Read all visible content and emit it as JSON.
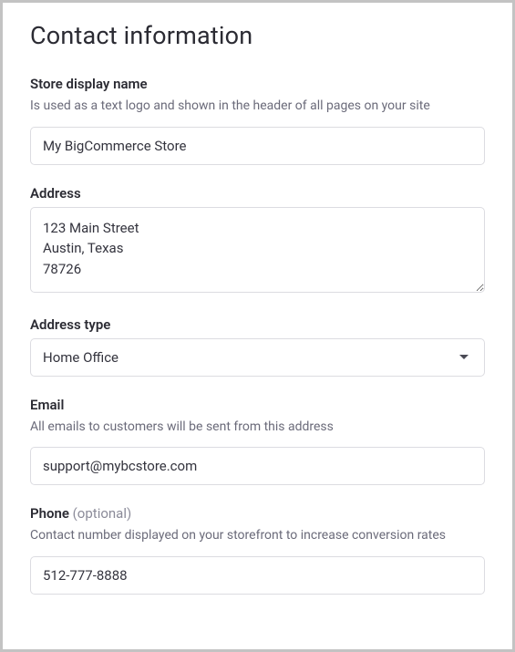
{
  "section": {
    "title": "Contact information"
  },
  "fields": {
    "store_display_name": {
      "label": "Store display name",
      "help": "Is used as a text logo and shown in the header of all pages on your site",
      "value": "My BigCommerce Store"
    },
    "address": {
      "label": "Address",
      "value": "123 Main Street\nAustin, Texas\n78726"
    },
    "address_type": {
      "label": "Address type",
      "selected": "Home Office"
    },
    "email": {
      "label": "Email",
      "help": "All emails to customers will be sent from this address",
      "value": "support@mybcstore.com"
    },
    "phone": {
      "label": "Phone",
      "optional_suffix": "(optional)",
      "help": "Contact number displayed on your storefront to increase conversion rates",
      "value": "512-777-8888"
    }
  }
}
